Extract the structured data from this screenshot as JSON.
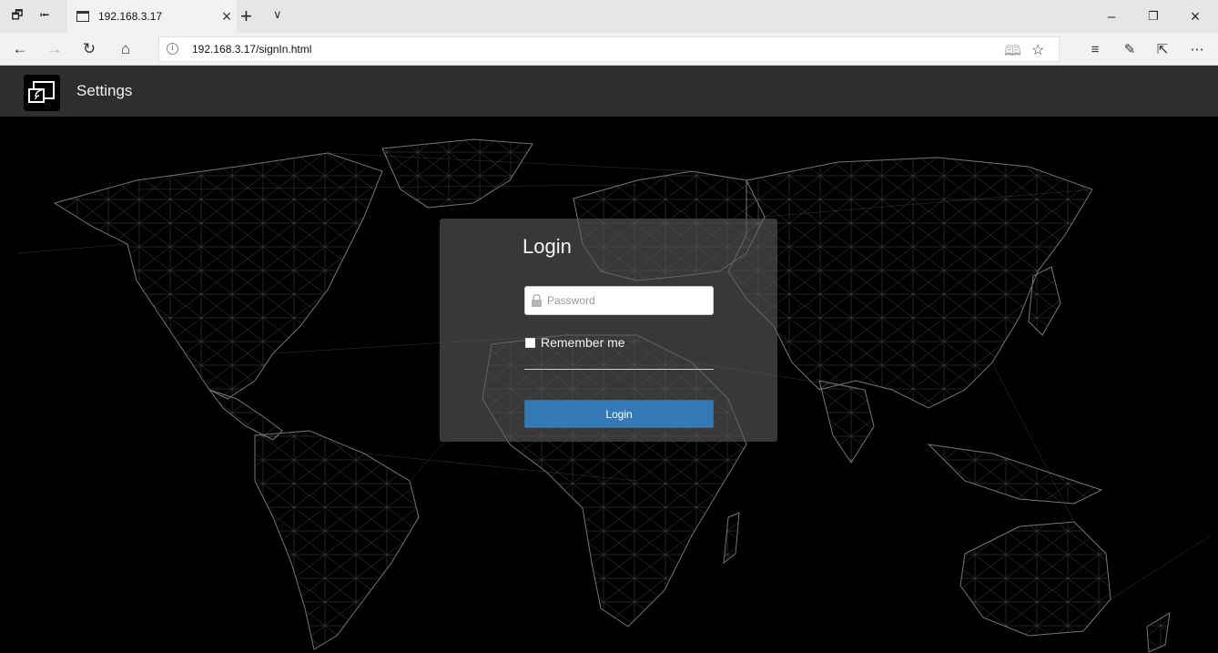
{
  "browser": {
    "tab": {
      "title": "192.168.3.17"
    },
    "address_bar": {
      "url": "192.168.3.17/signIn.html"
    },
    "icons": {
      "tab_actions": [
        "tabs-aside-icon",
        "set-tabs-aside-icon"
      ],
      "nav": [
        "back-icon",
        "forward-icon",
        "refresh-icon",
        "home-icon"
      ],
      "address_right": [
        "reading-view-icon",
        "favorite-star-icon"
      ],
      "toolbar": [
        "favorites-hub-icon",
        "add-notes-icon",
        "share-icon",
        "more-icon"
      ],
      "window": [
        "minimize-icon",
        "restore-icon",
        "close-window-icon"
      ]
    }
  },
  "app": {
    "title": "Settings",
    "logo_icon": "screen-cast-icon"
  },
  "login": {
    "heading": "Login",
    "password_placeholder": "Password",
    "password_value": "",
    "remember_label": "Remember me",
    "remember_checked": false,
    "button_label": "Login",
    "accent_color": "#337ab7"
  },
  "background": {
    "description_icon": "world-map-network-background"
  }
}
